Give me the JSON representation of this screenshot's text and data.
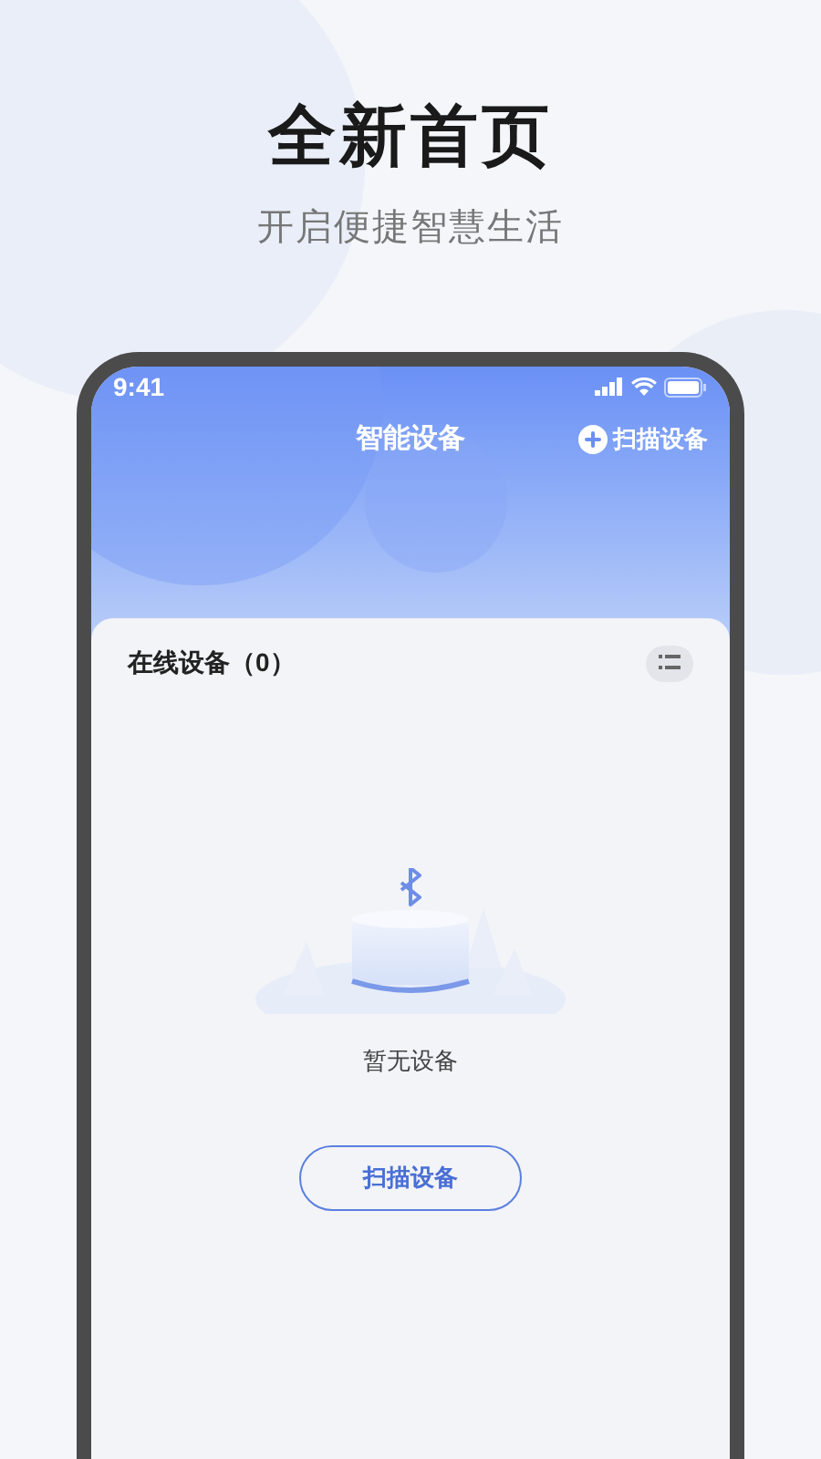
{
  "headline": "全新首页",
  "subheadline": "开启便捷智慧生活",
  "status_bar": {
    "time": "9:41"
  },
  "nav": {
    "title": "智能设备",
    "action": "扫描设备"
  },
  "section": {
    "title": "在线设备（0）"
  },
  "empty_state": {
    "message": "暂无设备",
    "button": "扫描设备"
  }
}
